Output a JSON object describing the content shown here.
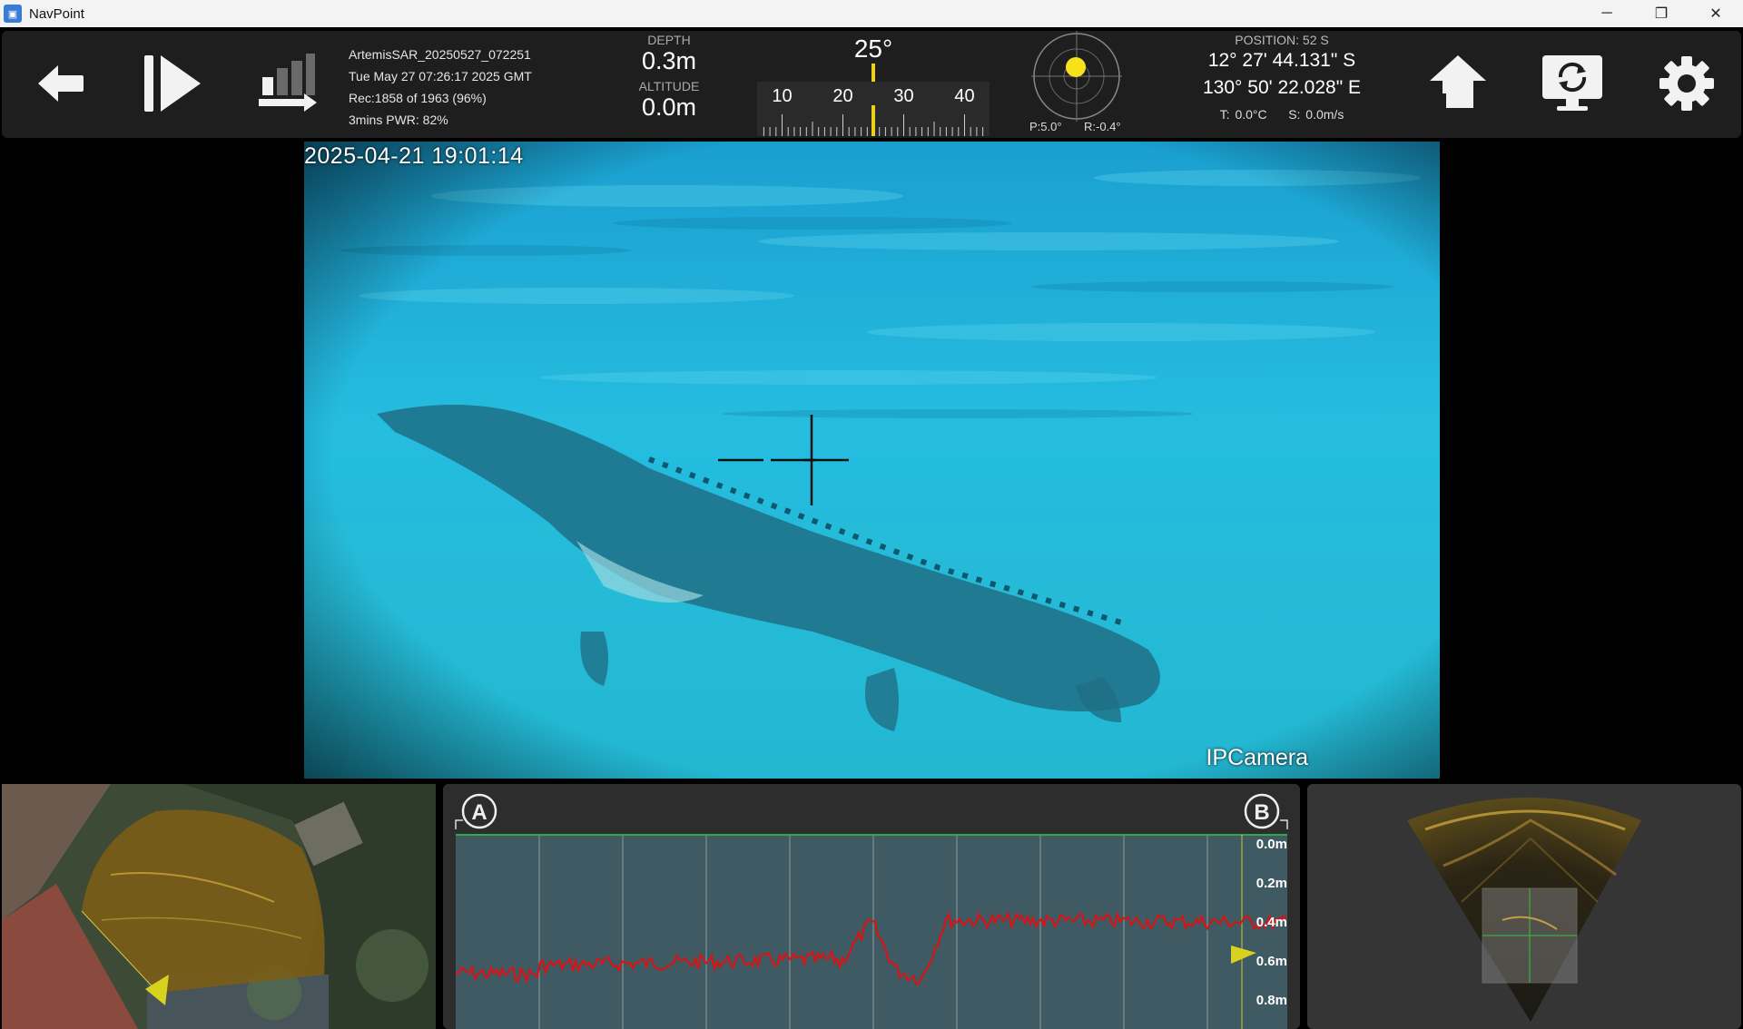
{
  "window": {
    "title": "NavPoint",
    "controls": {
      "minimize": "─",
      "maximize": "❐",
      "close": "✕"
    }
  },
  "toolbar": {
    "buttons": [
      "back-arrow-icon",
      "play-pause-icon",
      "record-level-icon",
      "home-icon",
      "screen-rotate-icon",
      "gear-icon"
    ],
    "recording": {
      "name": "ArtemisSAR_20250527_072251",
      "datetime": "Tue May 27 07:26:17 2025 GMT",
      "records": "Rec:1858 of 1963 (96%)",
      "power": "3mins PWR: 82%"
    },
    "depth": {
      "label": "DEPTH",
      "value": "0.3m"
    },
    "altitude": {
      "label": "ALTITUDE",
      "value": "0.0m"
    },
    "heading": {
      "value": "25°",
      "ticks": [
        "10",
        "20",
        "30",
        "40"
      ],
      "needle_degrees": 25,
      "accent": "#e8d21a"
    },
    "attitude": {
      "pitch": "P:5.0°",
      "roll": "R:-0.4°",
      "pitch_degrees": 5.0,
      "roll_degrees": -0.4,
      "dot_color": "#f5e21c"
    },
    "position": {
      "header": "POSITION: 52 S",
      "lat": "12° 27' 44.131\" S",
      "lon": "130° 50' 22.028\" E",
      "temperature": "T: 0.0°C",
      "speed": "S: 0.0m/s"
    }
  },
  "video": {
    "timestamp": "2025-04-21 19:01:14",
    "camera_label": "IPCamera",
    "water_color": "#1fb3d2"
  },
  "profile": {
    "marker_a": "A",
    "marker_b": "B",
    "depth_labels": [
      "0.0m",
      "0.2m",
      "0.4m",
      "0.6m",
      "0.8m"
    ],
    "line_color": "#e01010",
    "surface_color": "#2ea84a",
    "cursor_color": "#d7d21e"
  }
}
